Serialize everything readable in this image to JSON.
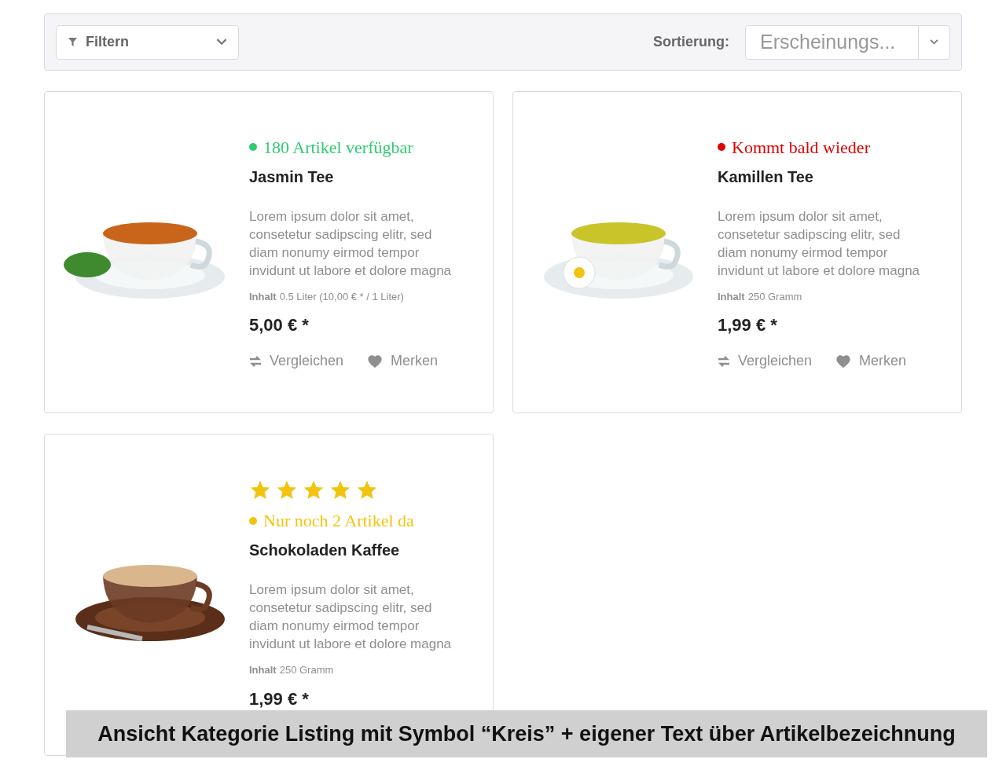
{
  "toolbar": {
    "filter_label": "Filtern",
    "sort_label": "Sortierung:",
    "sort_value": "Erscheinungs..."
  },
  "products": [
    {
      "kind": "picture",
      "status": {
        "text": "180 Artikel verfügbar",
        "color": "#2ecc71"
      },
      "name": "Jasmin Tee",
      "description": "Lorem ipsum dolor sit amet, consetetur sadipscing elitr, sed diam nonumy eirmod tempor invidunt ut labore et dolore magna",
      "content_label": "Inhalt",
      "content_value": "0.5 Liter (10,00 € * / 1 Liter)",
      "price": "5,00 € *",
      "actions": [
        {
          "kind": "compare",
          "label": "Vergleichen"
        },
        {
          "kind": "wishlist",
          "label": "Merken"
        }
      ]
    },
    {
      "kind": "picture",
      "status": {
        "text": "Kommt bald wieder",
        "color": "#e00000"
      },
      "name": "Kamillen Tee",
      "description": "Lorem ipsum dolor sit amet, consetetur sadipscing elitr, sed diam nonumy eirmod tempor invidunt ut labore et dolore magna",
      "content_label": "Inhalt",
      "content_value": "250 Gramm",
      "price": "1,99 € *",
      "actions": [
        {
          "kind": "compare",
          "label": "Vergleichen"
        },
        {
          "kind": "wishlist",
          "label": "Merken"
        }
      ]
    },
    {
      "kind": "picture",
      "stars": 5,
      "status": {
        "text": "Nur noch 2 Artikel da",
        "color": "#f1c40f"
      },
      "name": "Schokoladen Kaffee",
      "description": "Lorem ipsum dolor sit amet, consetetur sadipscing elitr, sed diam nonumy eirmod tempor invidunt ut labore et dolore magna",
      "content_label": "Inhalt",
      "content_value": "250 Gramm",
      "price": "1,99 € *"
    }
  ],
  "caption": "Ansicht Kategorie Listing mit Symbol “Kreis” + eigener Text über Artikelbezeichnung"
}
